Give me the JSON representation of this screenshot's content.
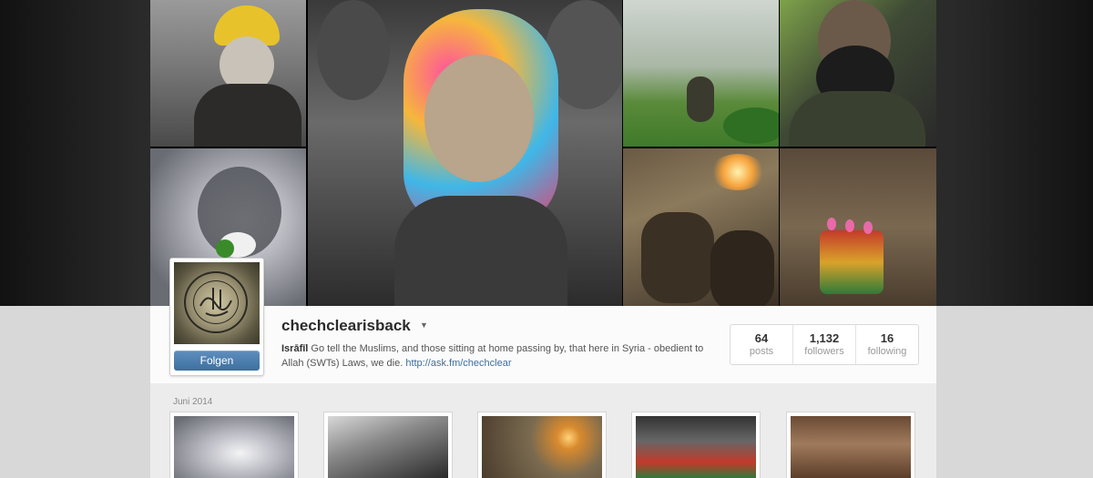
{
  "profile": {
    "username": "chechclearisback",
    "follow_label": "Folgen",
    "bio_name": "Isrāfīl",
    "bio_text": " Go tell the Muslims, and those sitting at home passing by, that here in Syria - obedient to Allah (SWTs) Laws, we die. ",
    "bio_link": "http://ask.fm/chechclear"
  },
  "stats": {
    "posts_count": "64",
    "posts_label": "posts",
    "followers_count": "1,132",
    "followers_label": "followers",
    "following_count": "16",
    "following_label": "following"
  },
  "feed": {
    "month_label": "Juni 2014"
  },
  "colors": {
    "follow_button": "#4a7cae",
    "link": "#3d6f9f",
    "stage_background": "#2a2a2a",
    "profile_background": "#fbfbfb"
  }
}
